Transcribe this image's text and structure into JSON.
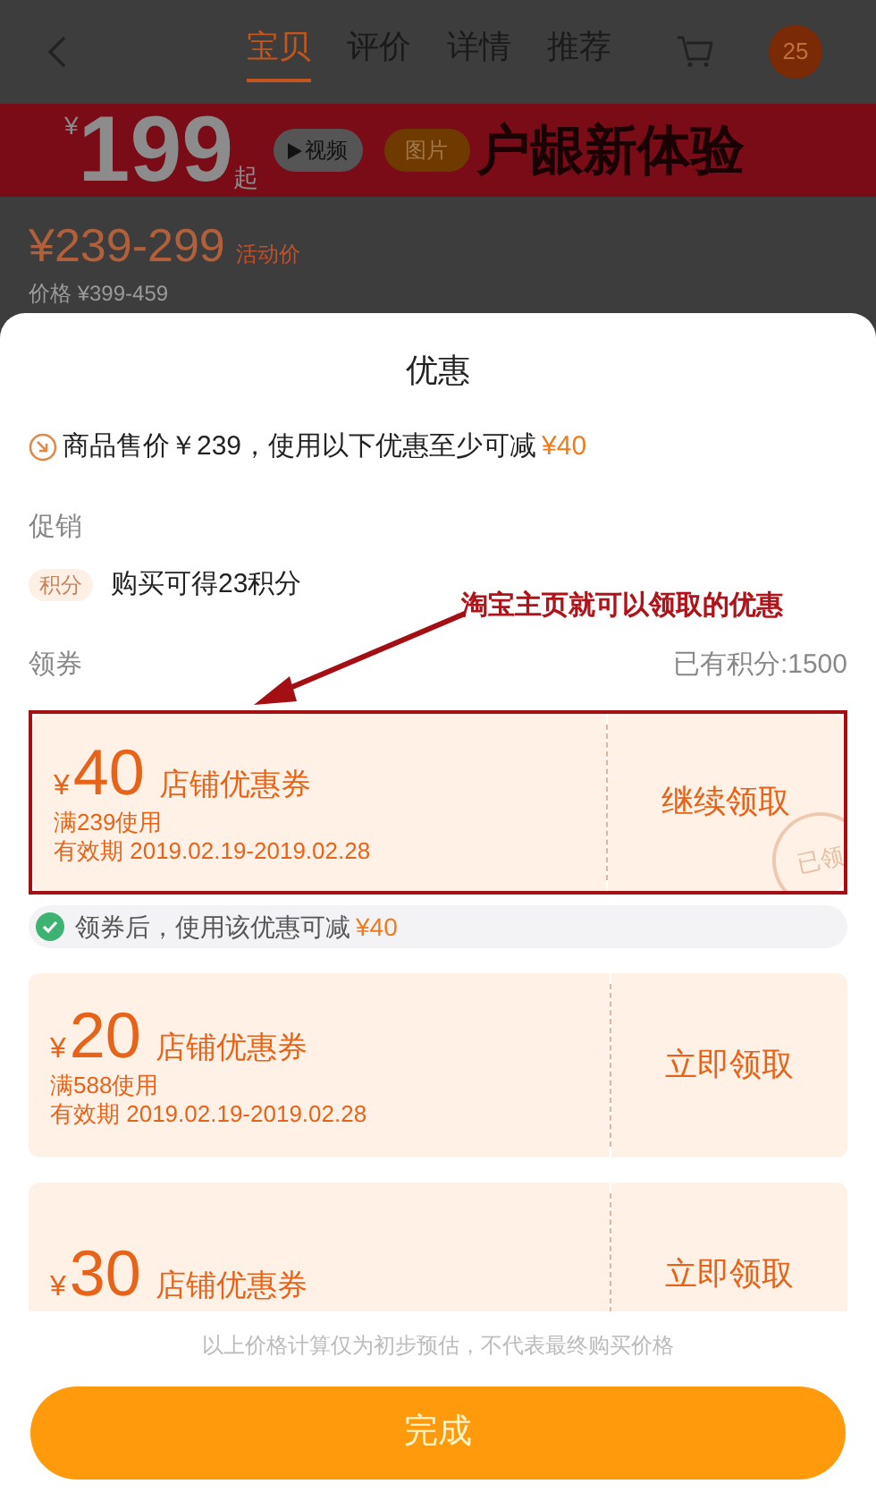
{
  "nav": {
    "tabs": [
      {
        "label": "宝贝",
        "selected": true
      },
      {
        "label": "评价",
        "selected": false
      },
      {
        "label": "详情",
        "selected": false
      },
      {
        "label": "推荐",
        "selected": false
      }
    ],
    "badge": "25"
  },
  "banner": {
    "currency": "¥",
    "price": "199",
    "suffix": "起",
    "video": "视频",
    "picture": "图片",
    "slogan": "户龈新体验"
  },
  "product": {
    "price": "¥239-299",
    "price_tag": "活动价",
    "original": "价格 ¥399-459"
  },
  "sheet": {
    "title": "优惠",
    "summary": {
      "text": "商品售价￥239，使用以下优惠至少可减",
      "amount": "¥40"
    },
    "promo_label": "促销",
    "promo": {
      "tag": "积分",
      "text": "购买可得23积分"
    },
    "coupon_label": "领券",
    "points": "已有积分:1500",
    "coupons": [
      {
        "currency": "¥",
        "amount": "40",
        "title": "店铺优惠券",
        "condition": "满239使用",
        "validity": "有效期 2019.02.19-2019.02.28",
        "action": "继续领取",
        "claimed": true,
        "stamp": "已领",
        "highlighted": true,
        "note": {
          "text": "领券后，使用该优惠可减",
          "amount": "¥40"
        }
      },
      {
        "currency": "¥",
        "amount": "20",
        "title": "店铺优惠券",
        "condition": "满588使用",
        "validity": "有效期 2019.02.19-2019.02.28",
        "action": "立即领取",
        "claimed": false,
        "highlighted": false
      },
      {
        "currency": "¥",
        "amount": "30",
        "title": "店铺优惠券",
        "action": "立即领取",
        "claimed": false,
        "highlighted": false
      }
    ],
    "disclaimer": "以上价格计算仅为初步预估，不代表最终购买价格",
    "done": "完成"
  },
  "annotation": "淘宝主页就可以领取的优惠"
}
